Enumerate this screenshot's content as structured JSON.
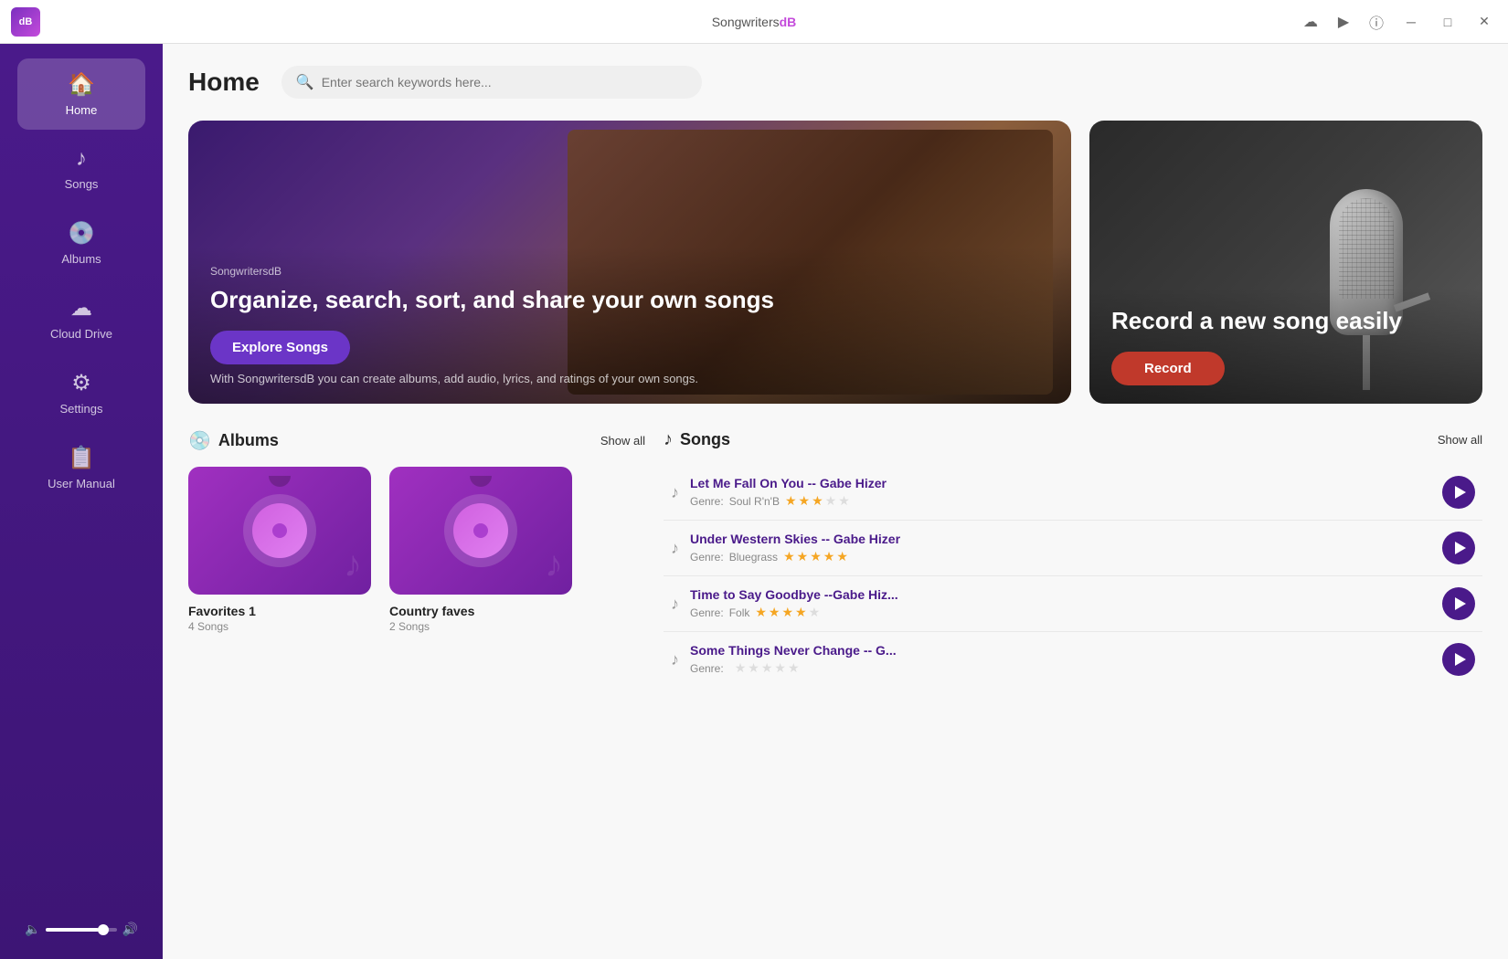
{
  "app": {
    "title_left": "Songwriters",
    "title_right": "dB",
    "logo_text": "dB"
  },
  "titlebar": {
    "cloud_icon": "☁",
    "play_icon": "▶",
    "info_icon": "ⓘ",
    "minimize_icon": "─",
    "maximize_icon": "□",
    "close_icon": "✕"
  },
  "sidebar": {
    "items": [
      {
        "id": "home",
        "label": "Home",
        "icon": "🏠",
        "active": true
      },
      {
        "id": "songs",
        "label": "Songs",
        "icon": "♪"
      },
      {
        "id": "albums",
        "label": "Albums",
        "icon": "💿"
      },
      {
        "id": "cloud",
        "label": "Cloud Drive",
        "icon": "☁"
      },
      {
        "id": "settings",
        "label": "Settings",
        "icon": "⚙"
      },
      {
        "id": "manual",
        "label": "User Manual",
        "icon": "📋"
      }
    ],
    "volume_label": "🔊"
  },
  "header": {
    "page_title": "Home",
    "search_placeholder": "Enter search keywords here..."
  },
  "hero_left": {
    "tag": "SongwritersdB",
    "title": "Organize, search, sort, and share your own songs",
    "subtitle": "With SongwritersdB you can create albums, add audio, lyrics, and ratings of your own songs.",
    "button_label": "Explore Songs"
  },
  "hero_right": {
    "title": "Record a new song easily",
    "button_label": "Record"
  },
  "albums_section": {
    "title": "Albums",
    "show_all": "Show all",
    "items": [
      {
        "name": "Favorites 1",
        "count": "4 Songs"
      },
      {
        "name": "Country faves",
        "count": "2 Songs"
      }
    ]
  },
  "songs_section": {
    "title": "Songs",
    "show_all": "Show all",
    "items": [
      {
        "title": "Let Me Fall On You -- Gabe Hizer",
        "genre_label": "Genre:",
        "genre": "Soul R'n'B",
        "stars": [
          1,
          1,
          1,
          0,
          0
        ]
      },
      {
        "title": "Under Western Skies -- Gabe Hizer",
        "genre_label": "Genre:",
        "genre": "Bluegrass",
        "stars": [
          1,
          1,
          1,
          1,
          1
        ]
      },
      {
        "title": "Time to Say Goodbye --Gabe Hiz...",
        "genre_label": "Genre:",
        "genre": "Folk",
        "stars": [
          1,
          1,
          1,
          1,
          0
        ]
      },
      {
        "title": "Some Things Never Change -- G...",
        "genre_label": "Genre:",
        "genre": "",
        "stars": [
          0,
          0,
          0,
          0,
          0
        ]
      }
    ]
  }
}
